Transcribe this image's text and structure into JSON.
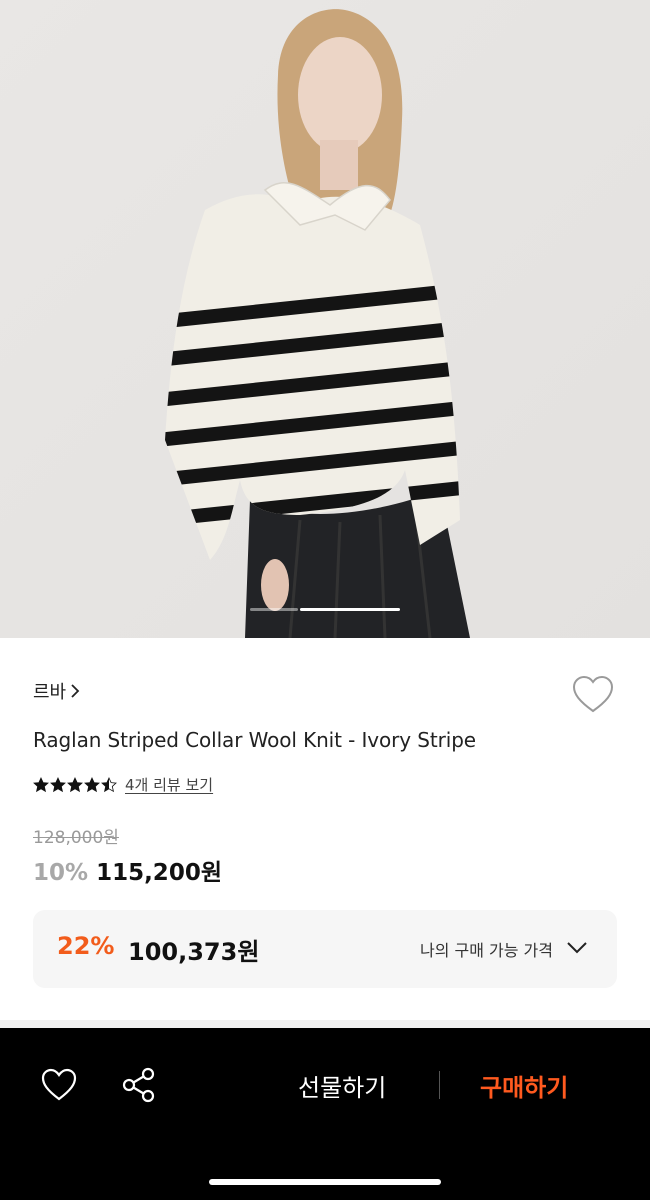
{
  "product": {
    "brand": "르바",
    "title": "Raglan Striped Collar Wool Knit - Ivory Stripe",
    "rating": 4.5,
    "review_link": "4개 리뷰 보기",
    "original_price": "128,000원",
    "discount_percent": "10%",
    "sale_price": "115,200원"
  },
  "my_price": {
    "discount_percent": "22%",
    "price": "100,373원",
    "label": "나의 구매 가능 가격"
  },
  "gallery": {
    "slide_count": 2,
    "active_slide": 2
  },
  "bottom_bar": {
    "gift_label": "선물하기",
    "buy_label": "구매하기"
  },
  "colors": {
    "accent": "#f25c1b",
    "buy": "#ff5a1f",
    "bar_bg": "#000000"
  }
}
